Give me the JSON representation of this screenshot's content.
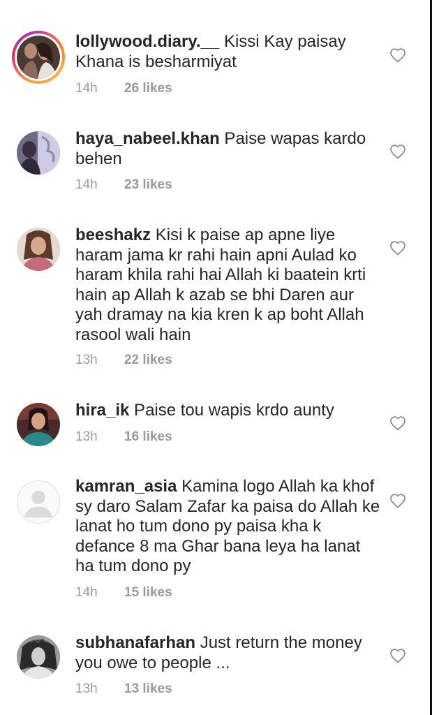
{
  "comments": [
    {
      "username": "lollywood.diary.__",
      "text": " Kissi Kay paisay Khana is besharmiyat",
      "time": "14h",
      "likes": "26 likes",
      "avatar": "photo-couple",
      "has_story_ring": true
    },
    {
      "username": "haya_nabeel.khan",
      "text": " Paise wapas kardo behen",
      "time": "14h",
      "likes": "23 likes",
      "avatar": "photo-two-people"
    },
    {
      "username": "beeshakz",
      "text": " Kisi k paise ap apne liye haram jama kr rahi hain apni Aulad ko haram khila rahi hai Allah ki baatein krti hain ap Allah k azab se bhi Daren aur yah dramay na kia kren k ap boht Allah rasool wali hain",
      "time": "13h",
      "likes": "22 likes",
      "avatar": "photo-woman"
    },
    {
      "username": "hira_ik",
      "text": " Paise tou wapis krdo aunty",
      "time": "13h",
      "likes": "16 likes",
      "avatar": "photo-woman-teal"
    },
    {
      "username": "kamran_asia",
      "text": " Kamina logo Allah ka khof sy daro Salam Zafar ka paisa do Allah ke lanat ho tum dono py paisa kha k defance 8 ma Ghar bana leya ha  lanat ha tum dono py",
      "time": "14h",
      "likes": "15 likes",
      "avatar": "default-avatar"
    },
    {
      "username": "subhanafarhan",
      "text": " Just return the money you owe to people ...",
      "time": "13h",
      "likes": "13 likes",
      "avatar": "photo-bw-portrait"
    }
  ],
  "colors": {
    "text": "#262626",
    "meta": "#9a9a9a",
    "heart_stroke": "#8e8e8e",
    "ring_start": "#f9a13b",
    "ring_end": "#b62bb5"
  },
  "icons": {
    "like": "heart-outline-icon"
  }
}
